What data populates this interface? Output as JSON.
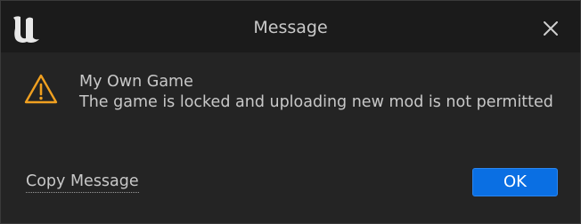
{
  "window": {
    "title": "Message",
    "logo_icon": "unreal-logo-icon",
    "close_icon": "close-icon"
  },
  "body": {
    "icon": "warning-icon",
    "icon_color": "#f0a020",
    "heading": "My Own Game",
    "message": "The game is locked and uploading new mod is not permitted"
  },
  "footer": {
    "copy_label": "Copy Message",
    "ok_label": "OK",
    "ok_color": "#0a6fe3"
  }
}
